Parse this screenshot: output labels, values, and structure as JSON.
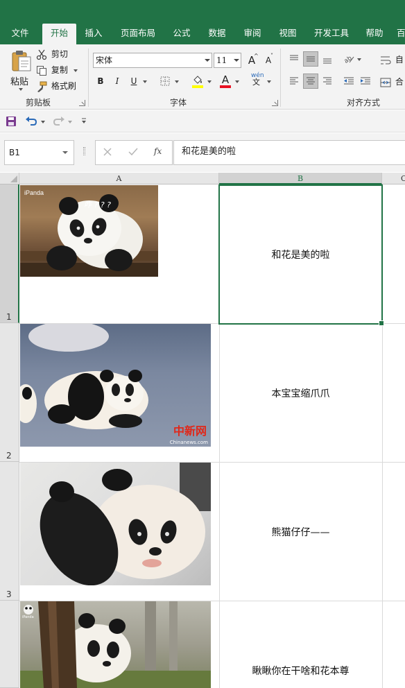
{
  "ribbon_tabs": [
    "文件",
    "开始",
    "插入",
    "页面布局",
    "公式",
    "数据",
    "审阅",
    "视图",
    "开发工具",
    "帮助",
    "百"
  ],
  "active_tab": "开始",
  "clipboard": {
    "paste_label": "粘贴",
    "cut_label": "剪切",
    "copy_label": "复制",
    "format_painter_label": "格式刷",
    "group_label": "剪贴板"
  },
  "font": {
    "name": "宋体",
    "size": "11",
    "group_label": "字体",
    "bold": "B",
    "italic": "I",
    "underline": "U",
    "grow": "A",
    "shrink": "A",
    "wen": "wén",
    "wen_char": "文",
    "font_color": "#e81123",
    "fill_color": "#ffff00"
  },
  "alignment": {
    "group_label": "对齐方式",
    "wrap_label": "自",
    "merge_label": "合"
  },
  "name_box": "B1",
  "formula_content": "和花是美的啦",
  "grid": {
    "columns": [
      "A",
      "B",
      "C"
    ],
    "rows": [
      "1",
      "2",
      "3",
      "4"
    ],
    "selected_cell": "B1",
    "cells_b": [
      "和花是美的啦",
      "本宝宝缩爪爪",
      "熊猫仔仔——",
      "瞅瞅你在干啥和花本尊"
    ],
    "photo1_watermark": "iPanda",
    "photo1_caption": "咋 ? ? ?",
    "photo2_watermark": "中新网",
    "photo2_watermark_sub": "Chinanews.com",
    "photo4_watermark": "iPanda"
  },
  "colors": {
    "excel_green": "#217346",
    "ribbon_bg": "#f3f3f3"
  }
}
